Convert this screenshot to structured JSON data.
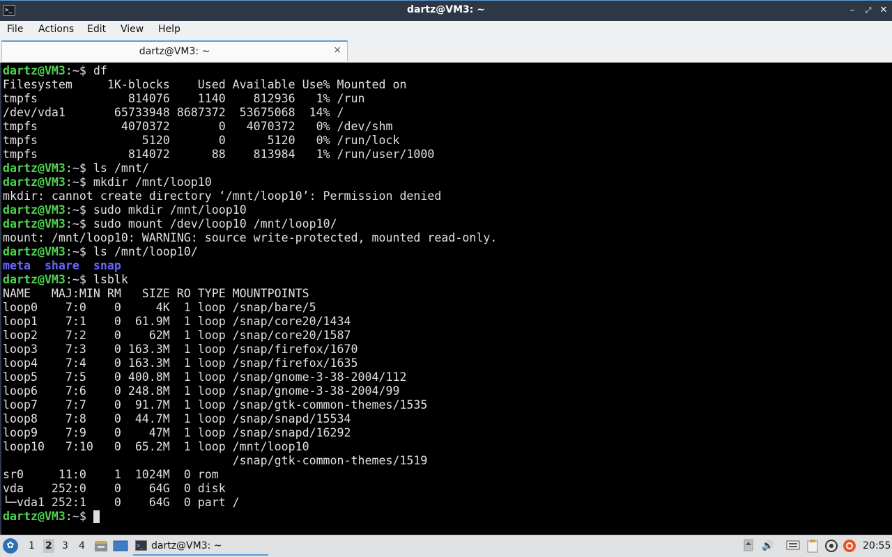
{
  "window": {
    "title": "dartz@VM3: ~"
  },
  "menu": {
    "file": "File",
    "actions": "Actions",
    "edit": "Edit",
    "view": "View",
    "help": "Help"
  },
  "tab": {
    "label": "dartz@VM3: ~",
    "close": "×"
  },
  "terminal": {
    "prompt": "dartz@VM3",
    "lines": [
      {
        "cmd": " df"
      },
      {
        "text": "Filesystem     1K-blocks    Used Available Use% Mounted on"
      },
      {
        "text": "tmpfs             814076    1140    812936   1% /run"
      },
      {
        "text": "/dev/vda1       65733948 8687372  53675068  14% /"
      },
      {
        "text": "tmpfs            4070372       0   4070372   0% /dev/shm"
      },
      {
        "text": "tmpfs               5120       0      5120   0% /run/lock"
      },
      {
        "text": "tmpfs             814072      88    813984   1% /run/user/1000"
      },
      {
        "cmd": " ls /mnt/"
      },
      {
        "cmd": " mkdir /mnt/loop10"
      },
      {
        "text": "mkdir: cannot create directory ‘/mnt/loop10’: Permission denied"
      },
      {
        "cmd": " sudo mkdir /mnt/loop10"
      },
      {
        "cmd": " sudo mount /dev/loop10 /mnt/loop10/"
      },
      {
        "text": "mount: /mnt/loop10: WARNING: source write-protected, mounted read-only."
      },
      {
        "cmd": " ls /mnt/loop10/"
      },
      {
        "dirs": "meta  share  snap"
      },
      {
        "cmd": " lsblk"
      },
      {
        "text": "NAME   MAJ:MIN RM   SIZE RO TYPE MOUNTPOINTS"
      },
      {
        "text": "loop0    7:0    0     4K  1 loop /snap/bare/5"
      },
      {
        "text": "loop1    7:1    0  61.9M  1 loop /snap/core20/1434"
      },
      {
        "text": "loop2    7:2    0    62M  1 loop /snap/core20/1587"
      },
      {
        "text": "loop3    7:3    0 163.3M  1 loop /snap/firefox/1670"
      },
      {
        "text": "loop4    7:4    0 163.3M  1 loop /snap/firefox/1635"
      },
      {
        "text": "loop5    7:5    0 400.8M  1 loop /snap/gnome-3-38-2004/112"
      },
      {
        "text": "loop6    7:6    0 248.8M  1 loop /snap/gnome-3-38-2004/99"
      },
      {
        "text": "loop7    7:7    0  91.7M  1 loop /snap/gtk-common-themes/1535"
      },
      {
        "text": "loop8    7:8    0  44.7M  1 loop /snap/snapd/15534"
      },
      {
        "text": "loop9    7:9    0    47M  1 loop /snap/snapd/16292"
      },
      {
        "text": "loop10   7:10   0  65.2M  1 loop /mnt/loop10"
      },
      {
        "text": "                                 /snap/gtk-common-themes/1519"
      },
      {
        "text": "sr0     11:0    1  1024M  0 rom"
      },
      {
        "text": "vda    252:0    0    64G  0 disk"
      },
      {
        "text": "└─vda1 252:1    0    64G  0 part /"
      },
      {
        "cmd": " ",
        "cursor": true
      }
    ]
  },
  "taskbar": {
    "workspaces": [
      "1",
      "2",
      "3",
      "4"
    ],
    "active_workspace": "2",
    "task_label": "dartz@VM3: ~",
    "clock": "20:55",
    "accent": "#5b9bd5"
  }
}
